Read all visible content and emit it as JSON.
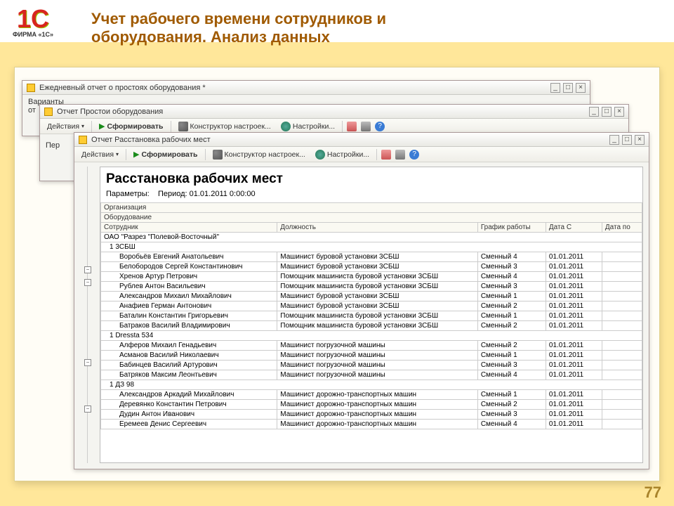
{
  "slide_number": "77",
  "logo": {
    "main": "1C",
    "sub": "ФИРМА «1С»"
  },
  "page_title_l1": "Учет рабочего времени сотрудников и",
  "page_title_l2": "оборудования. Анализ данных",
  "win1": {
    "title": "Ежедневный отчет о простоях оборудования *",
    "label_variants": "Варианты",
    "label_otbor": "от"
  },
  "win2": {
    "title": "Отчет  Простои оборудования",
    "actions": "Действия",
    "form": "Сформировать",
    "constr": "Конструктор настроек...",
    "settings": "Настройки...",
    "per": "Пер"
  },
  "win3": {
    "title": "Отчет  Расстановка рабочих мест",
    "actions": "Действия",
    "form": "Сформировать",
    "constr": "Конструктор настроек...",
    "settings": "Настройки...",
    "report_title": "Расстановка рабочих мест",
    "params_label": "Параметры:",
    "params_value": "Период: 01.01.2011 0:00:00",
    "col_org": "Организация",
    "col_equip": "Оборудование",
    "col_emp": "Сотрудник",
    "col_pos": "Должность",
    "col_schedule": "График работы",
    "col_date_from": "Дата С",
    "col_date_to": "Дата по",
    "org": "ОАО \"Разрез \"Полевой-Восточный\"",
    "groups": [
      {
        "name": "1 3СБШ",
        "rows": [
          {
            "emp": "Воробьёв Евгений Анатольевич",
            "pos": "Машинист буровой установки 3СБШ",
            "sch": "Сменный 4",
            "d1": "01.01.2011"
          },
          {
            "emp": "Белобородов Сергей Константинович",
            "pos": "Машинист буровой установки 3СБШ",
            "sch": "Сменный 3",
            "d1": "01.01.2011"
          },
          {
            "emp": "Хренов Артур Петрович",
            "pos": "Помощник машиниста буровой установки 3СБШ",
            "sch": "Сменный 4",
            "d1": "01.01.2011"
          },
          {
            "emp": "Рублев Антон Васильевич",
            "pos": "Помощник машиниста буровой установки 3СБШ",
            "sch": "Сменный 3",
            "d1": "01.01.2011"
          },
          {
            "emp": "Александров Михаил Михайлович",
            "pos": "Машинист буровой установки 3СБШ",
            "sch": "Сменный 1",
            "d1": "01.01.2011"
          },
          {
            "emp": "Анафиев Герман Антонович",
            "pos": "Машинист буровой установки 3СБШ",
            "sch": "Сменный 2",
            "d1": "01.01.2011"
          },
          {
            "emp": "Баталин Константин Григорьевич",
            "pos": "Помощник машиниста буровой установки 3СБШ",
            "sch": "Сменный 1",
            "d1": "01.01.2011"
          },
          {
            "emp": "Батраков Василий Владимирович",
            "pos": "Помощник машиниста буровой установки 3СБШ",
            "sch": "Сменный 2",
            "d1": "01.01.2011"
          }
        ]
      },
      {
        "name": "1 Dressta 534",
        "rows": [
          {
            "emp": "Алферов Михаил Генадьевич",
            "pos": "Машинист погрузочной машины",
            "sch": "Сменный 2",
            "d1": "01.01.2011"
          },
          {
            "emp": "Асманов Василий Николаевич",
            "pos": "Машинист погрузочной машины",
            "sch": "Сменный 1",
            "d1": "01.01.2011"
          },
          {
            "emp": "Бабинцев Василий Артурович",
            "pos": "Машинист погрузочной машины",
            "sch": "Сменный 3",
            "d1": "01.01.2011"
          },
          {
            "emp": "Батряков Максим Леонтьевич",
            "pos": "Машинист погрузочной машины",
            "sch": "Сменный 4",
            "d1": "01.01.2011"
          }
        ]
      },
      {
        "name": "1 ДЗ 98",
        "rows": [
          {
            "emp": "Александров Аркадий Михайлович",
            "pos": "Машинист дорожно-транспортных машин",
            "sch": "Сменный 1",
            "d1": "01.01.2011"
          },
          {
            "emp": "Деревянко Константин Петрович",
            "pos": "Машинист дорожно-транспортных машин",
            "sch": "Сменный 2",
            "d1": "01.01.2011"
          },
          {
            "emp": "Дудин Антон Иванович",
            "pos": "Машинист дорожно-транспортных машин",
            "sch": "Сменный 3",
            "d1": "01.01.2011"
          },
          {
            "emp": "Еремеев Денис Сергеевич",
            "pos": "Машинист дорожно-транспортных машин",
            "sch": "Сменный 4",
            "d1": "01.01.2011"
          }
        ]
      }
    ]
  }
}
